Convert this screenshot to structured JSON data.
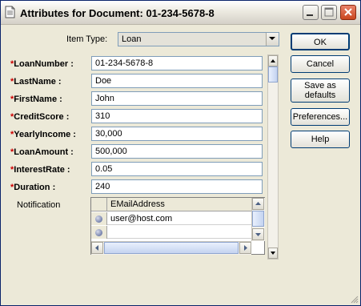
{
  "window": {
    "title": "Attributes for Document: 01-234-5678-8",
    "icons": {
      "doc": "document-icon",
      "minimize": "minimize-icon",
      "maximize": "maximize-icon",
      "close": "close-icon"
    }
  },
  "item_type": {
    "label": "Item Type:",
    "value": "Loan"
  },
  "fields": [
    {
      "label": "LoanNumber",
      "value": "01-234-5678-8",
      "required": true
    },
    {
      "label": "LastName",
      "value": "Doe",
      "required": true
    },
    {
      "label": "FirstName",
      "value": "John",
      "required": true
    },
    {
      "label": "CreditScore",
      "value": "310",
      "required": true
    },
    {
      "label": "YearlyIncome",
      "value": "30,000",
      "required": true
    },
    {
      "label": "LoanAmount",
      "value": "500,000",
      "required": true
    },
    {
      "label": "InterestRate",
      "value": "0.05",
      "required": true
    },
    {
      "label": "Duration",
      "value": "240",
      "required": true
    }
  ],
  "required_marker": "*",
  "label_suffix": ":",
  "notification": {
    "label": "Notification",
    "column": "EMailAddress",
    "rows": [
      "user@host.com",
      ""
    ]
  },
  "buttons": {
    "ok": "OK",
    "cancel": "Cancel",
    "save_defaults_line1": "Save as",
    "save_defaults_line2": "defaults",
    "preferences": "Preferences...",
    "help": "Help"
  },
  "colors": {
    "required": "#cc0000",
    "title_border": "#0a246a",
    "close_button": "#c9461e"
  }
}
